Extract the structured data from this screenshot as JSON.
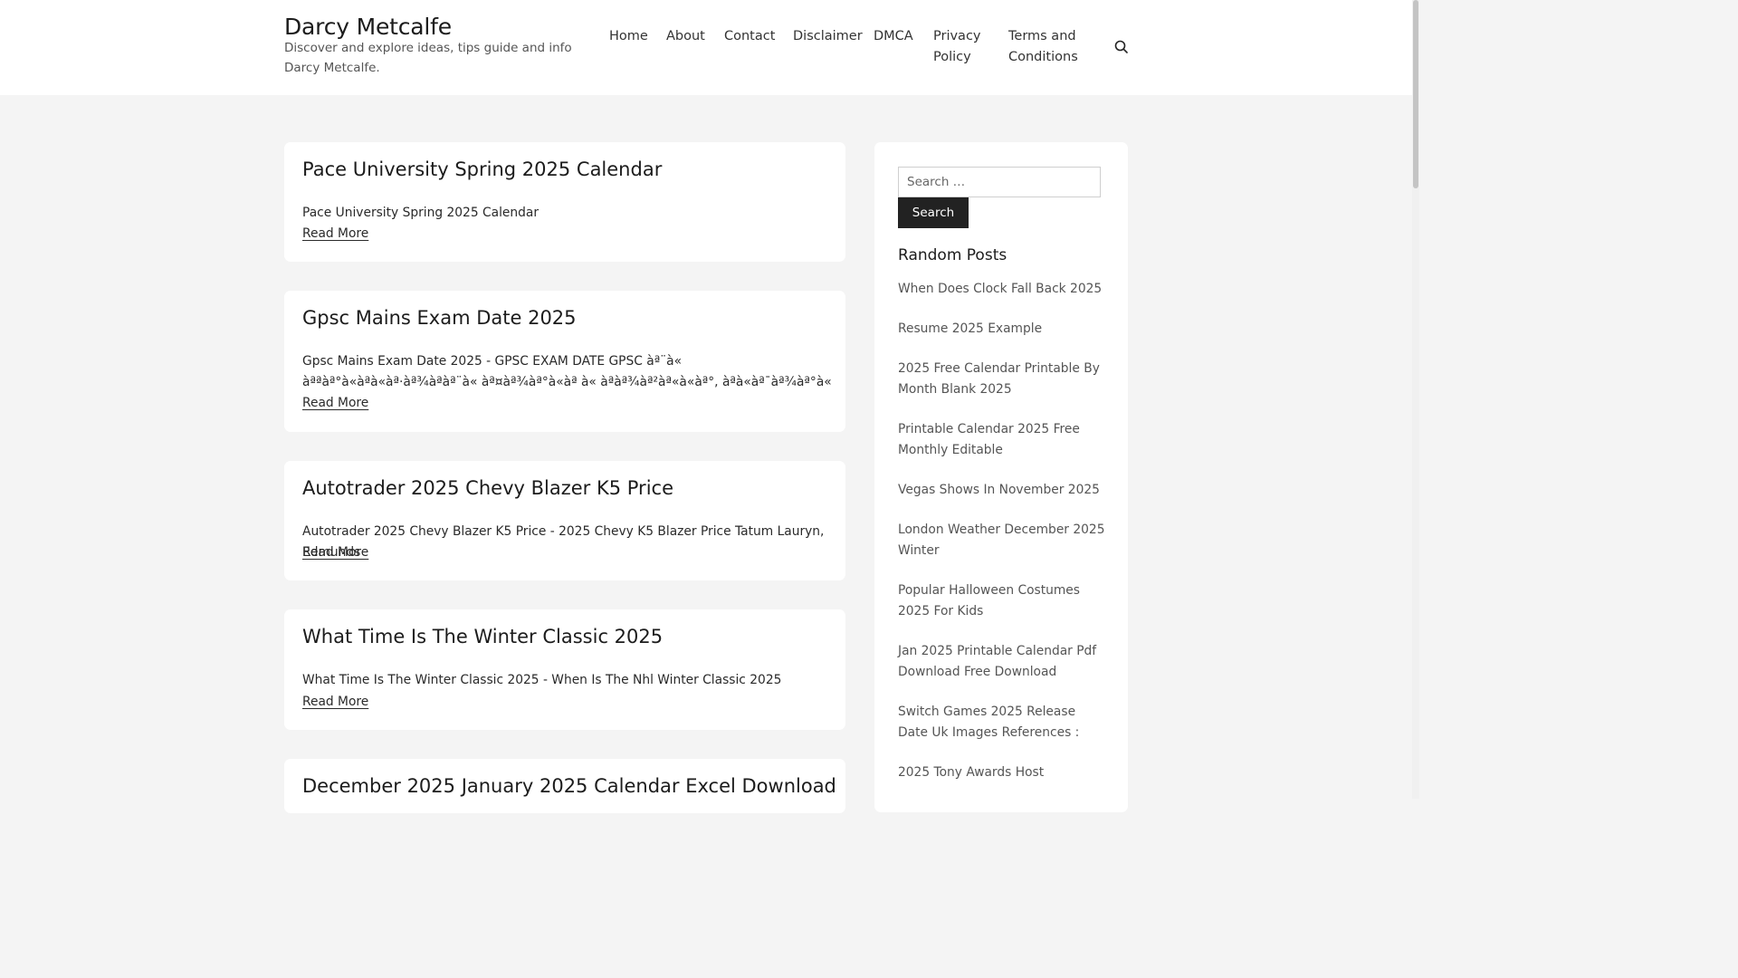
{
  "site": {
    "title": "Darcy Metcalfe",
    "description": "Discover and explore ideas, tips guide and info Darcy Metcalfe."
  },
  "nav": {
    "items": [
      {
        "label": "Home"
      },
      {
        "label": "About"
      },
      {
        "label": "Contact"
      },
      {
        "label": "Disclaimer"
      },
      {
        "label": "DMCA"
      },
      {
        "label": "Privacy Policy"
      },
      {
        "label": "Terms and Conditions"
      }
    ],
    "search_icon": "search-icon"
  },
  "posts": [
    {
      "title": "Pace University Spring 2025 Calendar",
      "excerpt": "Pace University Spring 2025 Calendar",
      "read_more": "Read More"
    },
    {
      "title": "Gpsc Mains Exam Date 2025",
      "excerpt": "Gpsc Mains Exam Date 2025 - GPSC EXAM DATE GPSC àª¨à« àªªàª°à«àªà«àª·àª¾àªàª¨à« àª¤àª¾àª°à«àª à« àªàª¾àª²àª«à«àª°, àªà«àª¯àª¾àª°à«",
      "read_more": "Read More"
    },
    {
      "title": "Autotrader 2025 Chevy Blazer K5 Price",
      "excerpt": "Autotrader 2025 Chevy Blazer K5 Price - 2025 Chevy K5 Blazer Price Tatum Lauryn, Edmunds",
      "read_more": "Read More"
    },
    {
      "title": "What Time Is The Winter Classic 2025",
      "excerpt": "What Time Is The Winter Classic 2025 - When Is The Nhl Winter Classic 2025",
      "read_more": "Read More"
    },
    {
      "title": "December 2025 January 2025 Calendar Excel Download",
      "excerpt": "",
      "read_more": ""
    }
  ],
  "sidebar": {
    "search_placeholder": "Search …",
    "search_button": "Search",
    "random_heading": "Random Posts",
    "random_posts": [
      "When Does Clock Fall Back 2025",
      "Resume 2025 Example",
      "2025 Free Calendar Printable By Month Blank 2025",
      "Printable Calendar 2025 Free Monthly Editable",
      "Vegas Shows In November 2025",
      "London Weather December 2025 Winter",
      "Popular Halloween Costumes 2025 For Kids",
      "Jan 2025 Printable Calendar Pdf Download Free Download",
      "Switch Games 2025 Release Date Uk Images References :",
      "2025 Tony Awards Host"
    ]
  }
}
